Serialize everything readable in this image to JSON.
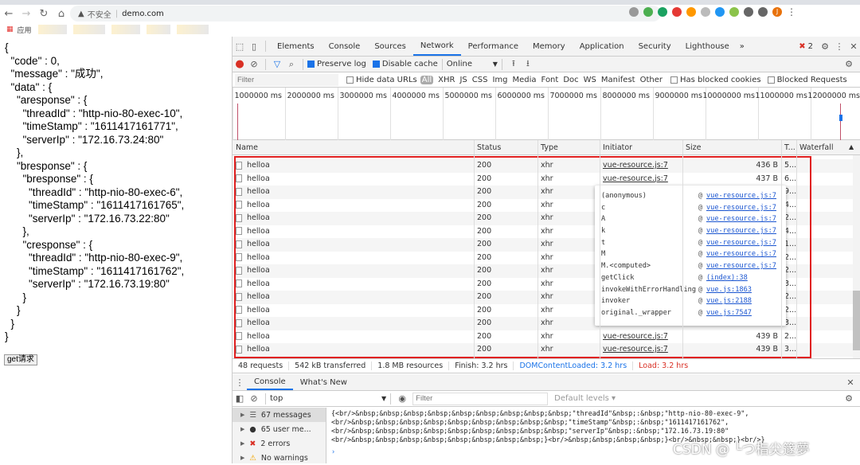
{
  "browser": {
    "insecure_label": "不安全",
    "host": "demo.com",
    "apps_label": "应用",
    "profile_initial": "J"
  },
  "page": {
    "json_lines": [
      "{",
      "  \"code\" : 0,",
      "  \"message\" : \"成功\",",
      "  \"data\" : {",
      "    \"aresponse\" : {",
      "      \"threadId\" : \"http-nio-80-exec-10\",",
      "      \"timeStamp\" : \"1611417161771\",",
      "      \"serverIp\" : \"172.16.73.24:80\"",
      "    },",
      "    \"bresponse\" : {",
      "      \"bresponse\" : {",
      "        \"threadId\" : \"http-nio-80-exec-6\",",
      "        \"timeStamp\" : \"1611417161765\",",
      "        \"serverIp\" : \"172.16.73.22:80\"",
      "      },",
      "      \"cresponse\" : {",
      "        \"threadId\" : \"http-nio-80-exec-9\",",
      "        \"timeStamp\" : \"1611417161762\",",
      "        \"serverIp\" : \"172.16.73.19:80\"",
      "      }",
      "    }",
      "  }",
      "}"
    ],
    "button_label": "get请求"
  },
  "devtools": {
    "tabs": [
      "Elements",
      "Console",
      "Sources",
      "Network",
      "Performance",
      "Memory",
      "Application",
      "Security",
      "Lighthouse"
    ],
    "active_tab": "Network",
    "more_tabs": "»",
    "error_count": "2",
    "toolbar": {
      "preserve_log": "Preserve log",
      "disable_cache": "Disable cache",
      "throttle": "Online"
    },
    "filter": {
      "placeholder": "Filter",
      "hide_data_urls": "Hide data URLs",
      "types": [
        "All",
        "XHR",
        "JS",
        "CSS",
        "Img",
        "Media",
        "Font",
        "Doc",
        "WS",
        "Manifest",
        "Other"
      ],
      "has_blocked_cookies": "Has blocked cookies",
      "blocked_requests": "Blocked Requests"
    },
    "timeline_ticks": [
      "1000000 ms",
      "2000000 ms",
      "3000000 ms",
      "4000000 ms",
      "5000000 ms",
      "6000000 ms",
      "7000000 ms",
      "8000000 ms",
      "9000000 ms",
      "10000000 ms",
      "11000000 ms",
      "12000000 ms"
    ],
    "columns": [
      "Name",
      "Status",
      "Type",
      "Initiator",
      "Size",
      "T...",
      "Waterfall"
    ],
    "rows": [
      {
        "name": "helloa",
        "status": "200",
        "type": "xhr",
        "initiator": "vue-resource.js:7",
        "size": "436 B",
        "time": "5..."
      },
      {
        "name": "helloa",
        "status": "200",
        "type": "xhr",
        "initiator": "vue-resource.js:7",
        "size": "437 B",
        "time": "6..."
      },
      {
        "name": "helloa",
        "status": "200",
        "type": "xhr",
        "initiator": "",
        "size": "",
        "time": "9..."
      },
      {
        "name": "helloa",
        "status": "200",
        "type": "xhr",
        "initiator": "",
        "size": "",
        "time": "4..."
      },
      {
        "name": "helloa",
        "status": "200",
        "type": "xhr",
        "initiator": "",
        "size": "",
        "time": "2..."
      },
      {
        "name": "helloa",
        "status": "200",
        "type": "xhr",
        "initiator": "",
        "size": "",
        "time": "4..."
      },
      {
        "name": "helloa",
        "status": "200",
        "type": "xhr",
        "initiator": "",
        "size": "",
        "time": "1..."
      },
      {
        "name": "helloa",
        "status": "200",
        "type": "xhr",
        "initiator": "",
        "size": "",
        "time": "2..."
      },
      {
        "name": "helloa",
        "status": "200",
        "type": "xhr",
        "initiator": "",
        "size": "",
        "time": "2..."
      },
      {
        "name": "helloa",
        "status": "200",
        "type": "xhr",
        "initiator": "",
        "size": "",
        "time": "3..."
      },
      {
        "name": "helloa",
        "status": "200",
        "type": "xhr",
        "initiator": "",
        "size": "",
        "time": "2..."
      },
      {
        "name": "helloa",
        "status": "200",
        "type": "xhr",
        "initiator": "",
        "size": "",
        "time": "2..."
      },
      {
        "name": "helloa",
        "status": "200",
        "type": "xhr",
        "initiator": "",
        "size": "",
        "time": "3..."
      },
      {
        "name": "helloa",
        "status": "200",
        "type": "xhr",
        "initiator": "vue-resource.js:7",
        "size": "439 B",
        "time": "2..."
      },
      {
        "name": "helloa",
        "status": "200",
        "type": "xhr",
        "initiator": "vue-resource.js:7",
        "size": "439 B",
        "time": "3..."
      }
    ],
    "initiator_stack": [
      {
        "fn": "(anonymous)",
        "loc": "vue-resource.js:7"
      },
      {
        "fn": "c",
        "loc": "vue-resource.js:7"
      },
      {
        "fn": "A",
        "loc": "vue-resource.js:7"
      },
      {
        "fn": "k",
        "loc": "vue-resource.js:7"
      },
      {
        "fn": "t",
        "loc": "vue-resource.js:7"
      },
      {
        "fn": "M",
        "loc": "vue-resource.js:7"
      },
      {
        "fn": "M.<computed>",
        "loc": "vue-resource.js:7"
      },
      {
        "fn": "getClick",
        "loc": "(index):38"
      },
      {
        "fn": "invokeWithErrorHandling",
        "loc": "vue.js:1863"
      },
      {
        "fn": "invoker",
        "loc": "vue.js:2188"
      },
      {
        "fn": "original._wrapper",
        "loc": "vue.js:7547"
      }
    ],
    "summary": {
      "requests": "48 requests",
      "transferred": "542 kB transferred",
      "resources": "1.8 MB resources",
      "finish": "Finish: 3.2 hrs",
      "dom": "DOMContentLoaded: 3.2 hrs",
      "load": "Load: 3.2 hrs"
    },
    "drawer_tabs": [
      "Console",
      "What's New"
    ],
    "console": {
      "context": "top",
      "filter_placeholder": "Filter",
      "levels": "Default levels ▾",
      "sidebar": [
        "67 messages",
        "65 user me...",
        "2 errors",
        "No warnings"
      ],
      "lines": [
        "{<br/>&nbsp;&nbsp;&nbsp;&nbsp;&nbsp;&nbsp;&nbsp;&nbsp;&nbsp;\"threadId\"&nbsp;:&nbsp;\"http-nio-80-exec-9\",",
        "<br/>&nbsp;&nbsp;&nbsp;&nbsp;&nbsp;&nbsp;&nbsp;&nbsp;&nbsp;\"timeStamp\"&nbsp;:&nbsp;\"1611417161762\",",
        "<br/>&nbsp;&nbsp;&nbsp;&nbsp;&nbsp;&nbsp;&nbsp;&nbsp;&nbsp;\"serverIp\"&nbsp;:&nbsp;\"172.16.73.19:80\"",
        "<br/>&nbsp;&nbsp;&nbsp;&nbsp;&nbsp;&nbsp;&nbsp;&nbsp;}<br/>&nbsp;&nbsp;&nbsp;&nbsp;}<br/>&nbsp;&nbsp;}<br/>}"
      ],
      "prompt": "›"
    }
  },
  "watermark": "CSDN @ └つ栺尖篴夢",
  "colors": {
    "accent": "#1a73e8",
    "error": "#d93025",
    "highlight_box": "#e02020",
    "dom_loaded": "#1a73e8",
    "load": "#d93025"
  }
}
